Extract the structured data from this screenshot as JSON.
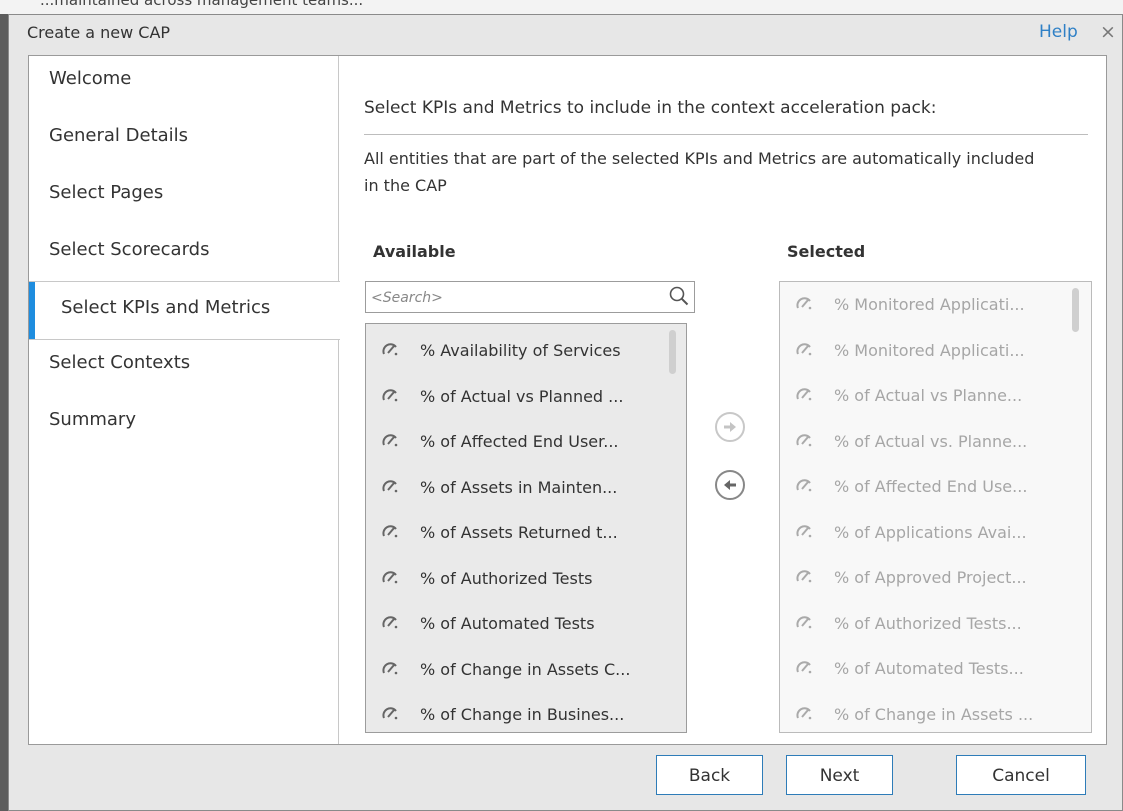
{
  "background_text": "...maintained across management teams...",
  "dialog": {
    "title": "Create a new CAP",
    "help_label": "Help",
    "close_glyph": "×"
  },
  "nav": {
    "items": [
      {
        "label": "Welcome"
      },
      {
        "label": "General Details"
      },
      {
        "label": "Select Pages"
      },
      {
        "label": "Select Scorecards"
      },
      {
        "label": "Select KPIs and Metrics",
        "active": true
      },
      {
        "label": "Select Contexts"
      },
      {
        "label": "Summary"
      }
    ]
  },
  "main": {
    "heading": "Select KPIs and Metrics to include in the context acceleration pack:",
    "description": "All entities that are part of the selected KPIs and Metrics are automatically included in the CAP",
    "available": {
      "label": "Available",
      "search_placeholder": "<Search>",
      "items": [
        "% Availability of Services",
        "% of Actual vs Planned ...",
        "% of Affected End User...",
        "% of Assets in Mainten...",
        "% of Assets Returned t...",
        "% of Authorized Tests",
        "% of Automated Tests",
        "% of Change in Assets C...",
        "% of Change in Busines..."
      ]
    },
    "selected": {
      "label": "Selected",
      "items": [
        "% Monitored Applicati...",
        "% Monitored Applicati...",
        "% of Actual vs Planne...",
        "% of Actual vs. Planne...",
        "% of Affected End Use...",
        "% of Applications Avai...",
        "% of Approved Project...",
        "% of Authorized Tests...",
        "% of Automated Tests...",
        "% of Change in Assets ..."
      ]
    }
  },
  "footer": {
    "back_label": "Back",
    "next_label": "Next",
    "cancel_label": "Cancel"
  },
  "colors": {
    "accent": "#1e8ddf",
    "link": "#2f80c6",
    "button_border": "#2e7cb8"
  }
}
